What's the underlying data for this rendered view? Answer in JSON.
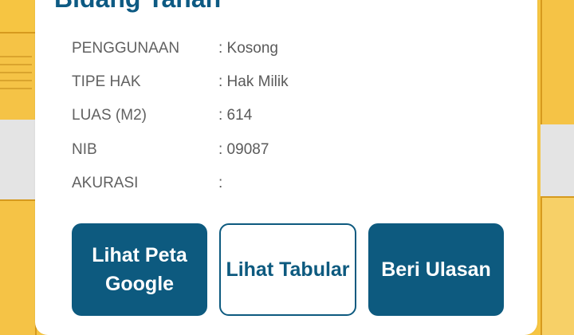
{
  "panel": {
    "title": "Bidang Tanah"
  },
  "details": [
    {
      "label": "PENGGUNAAN",
      "value": ": Kosong"
    },
    {
      "label": "TIPE HAK",
      "value": ": Hak Milik"
    },
    {
      "label": "LUAS (M2)",
      "value": ": 614"
    },
    {
      "label": "NIB",
      "value": ": 09087"
    },
    {
      "label": "AKURASI",
      "value": ":"
    }
  ],
  "actions": {
    "google_map_line1": "Lihat Peta",
    "google_map_line2": "Google",
    "tabular": "Lihat Tabular",
    "review": "Beri Ulasan"
  },
  "colors": {
    "primary": "#0d5a7f",
    "map_parcel": "#f5c346"
  }
}
